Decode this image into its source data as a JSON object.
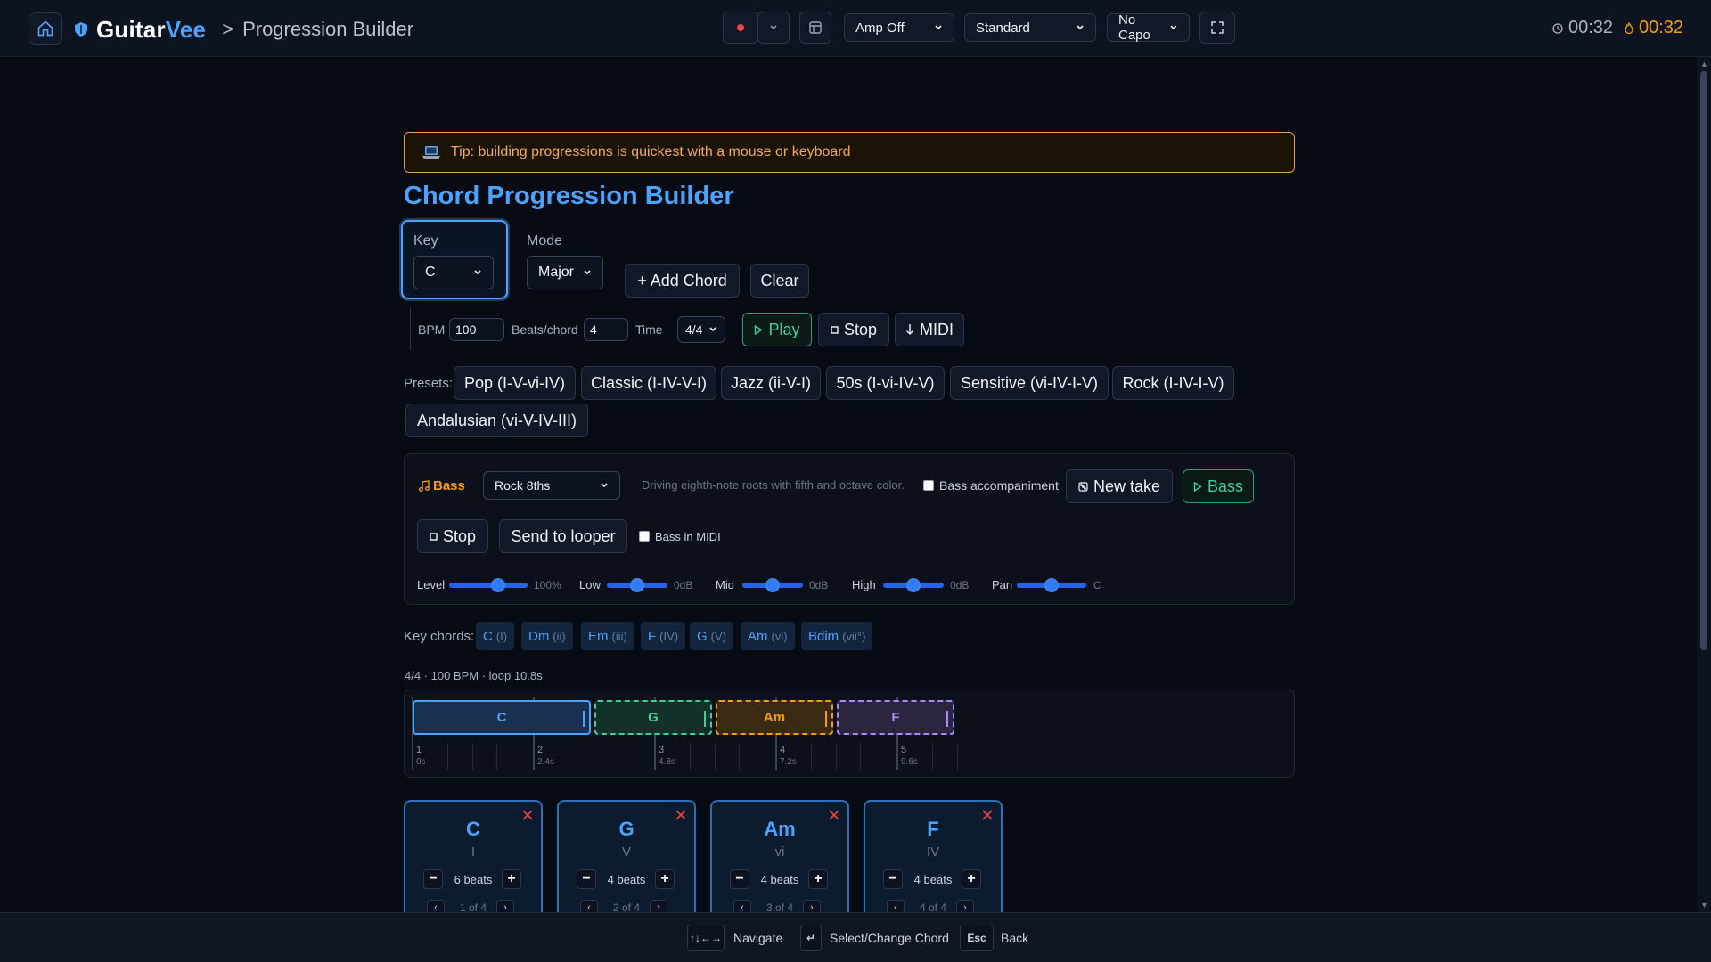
{
  "header": {
    "brand_prefix": "Guitar",
    "brand_suffix": "Vee",
    "crumb_sep": ">",
    "page": "Progression Builder",
    "amp": "Amp Off",
    "tuning": "Standard",
    "capo": "No Capo",
    "timer_1": "00:32",
    "timer_2": "00:32"
  },
  "tip": "Tip: building progressions is quickest with a mouse or keyboard",
  "title": "Chord Progression Builder",
  "controls": {
    "key_label": "Key",
    "key_value": "C",
    "mode_label": "Mode",
    "mode_value": "Major",
    "add_chord": "+ Add Chord",
    "clear": "Clear",
    "bpm_label": "BPM",
    "bpm_value": "100",
    "beats_label": "Beats/chord",
    "beats_value": "4",
    "time_label": "Time",
    "time_value": "4/4",
    "play": "Play",
    "stop": "Stop",
    "midi": "MIDI"
  },
  "presets": {
    "label": "Presets:",
    "items": [
      "Pop (I-V-vi-IV)",
      "Classic (I-IV-V-I)",
      "Jazz (ii-V-I)",
      "50s (I-vi-IV-V)",
      "Sensitive (vi-IV-I-V)",
      "Rock (I-IV-I-V)",
      "Andalusian (vi-V-IV-III)"
    ]
  },
  "bass": {
    "title": "Bass",
    "style": "Rock 8ths",
    "description": "Driving eighth-note roots with fifth and octave color.",
    "accompaniment_label": "Bass accompaniment",
    "new_take": "New take",
    "play": "Bass",
    "stop": "Stop",
    "send_to_looper": "Send to looper",
    "midi_label": "Bass in MIDI",
    "sliders": [
      {
        "label": "Level",
        "value": "100%",
        "level": 0.62
      },
      {
        "label": "Low",
        "value": "0dB",
        "level": 0.5
      },
      {
        "label": "Mid",
        "value": "0dB",
        "level": 0.5
      },
      {
        "label": "High",
        "value": "0dB",
        "level": 0.5
      },
      {
        "label": "Pan",
        "value": "C",
        "level": 0.5
      }
    ]
  },
  "key_chords": {
    "label": "Key chords:",
    "items": [
      {
        "name": "C",
        "roman": "(I)"
      },
      {
        "name": "Dm",
        "roman": "(ii)"
      },
      {
        "name": "Em",
        "roman": "(iii)"
      },
      {
        "name": "F",
        "roman": "(IV)"
      },
      {
        "name": "G",
        "roman": "(V)"
      },
      {
        "name": "Am",
        "roman": "(vi)"
      },
      {
        "name": "Bdim",
        "roman": "(vii°)"
      }
    ]
  },
  "timeline": {
    "info": "4/4 · 100 BPM · loop 10.8s",
    "bars": [
      {
        "num": "1",
        "time": "0s"
      },
      {
        "num": "2",
        "time": "2.4s"
      },
      {
        "num": "3",
        "time": "4.8s"
      },
      {
        "num": "4",
        "time": "7.2s"
      },
      {
        "num": "5",
        "time": "9.6s"
      }
    ],
    "blocks": [
      {
        "name": "C",
        "color": "#4aa3ff"
      },
      {
        "name": "G",
        "color": "#3ecf9a"
      },
      {
        "name": "Am",
        "color": "#f59e0b"
      },
      {
        "name": "F",
        "color": "#a78bfa"
      }
    ]
  },
  "cards": [
    {
      "name": "C",
      "roman": "I",
      "beats": "6 beats",
      "pos": "1 of 4"
    },
    {
      "name": "G",
      "roman": "V",
      "beats": "4 beats",
      "pos": "2 of 4"
    },
    {
      "name": "Am",
      "roman": "vi",
      "beats": "4 beats",
      "pos": "3 of 4"
    },
    {
      "name": "F",
      "roman": "IV",
      "beats": "4 beats",
      "pos": "4 of 4"
    }
  ],
  "footer": {
    "navigate_key": "↑↓←→",
    "navigate": "Navigate",
    "select_key": "↵",
    "select": "Select/Change Chord",
    "back_key": "Esc",
    "back": "Back"
  },
  "colors": {
    "accent": "#4aa3ff",
    "tip": "#f1a94c",
    "green": "#3ecf9a",
    "timer_active": "#f59e0b"
  }
}
